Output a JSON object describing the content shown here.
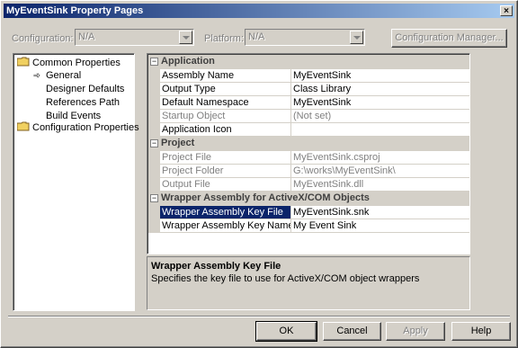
{
  "window": {
    "title": "MyEventSink Property Pages",
    "close_glyph": "×"
  },
  "toolbar": {
    "configuration_label": "Configuration:",
    "configuration_value": "N/A",
    "platform_label": "Platform:",
    "platform_value": "N/A",
    "config_manager_label": "Configuration Manager..."
  },
  "tree": {
    "items": [
      {
        "label": "Common Properties",
        "kind": "folder"
      },
      {
        "label": "General",
        "kind": "selected"
      },
      {
        "label": "Designer Defaults",
        "kind": "leaf"
      },
      {
        "label": "References Path",
        "kind": "leaf"
      },
      {
        "label": "Build Events",
        "kind": "leaf"
      },
      {
        "label": "Configuration Properties",
        "kind": "folder"
      }
    ]
  },
  "grid": {
    "categories": [
      {
        "name": "Application",
        "expander": "−",
        "rows": [
          {
            "name": "Assembly Name",
            "value": "MyEventSink"
          },
          {
            "name": "Output Type",
            "value": "Class Library"
          },
          {
            "name": "Default Namespace",
            "value": "MyEventSink"
          },
          {
            "name": "Startup Object",
            "value": "(Not set)"
          },
          {
            "name": "Application Icon",
            "value": ""
          }
        ]
      },
      {
        "name": "Project",
        "expander": "−",
        "rows": [
          {
            "name": "Project File",
            "value": "MyEventSink.csproj"
          },
          {
            "name": "Project Folder",
            "value": "G:\\works\\MyEventSink\\"
          },
          {
            "name": "Output File",
            "value": "MyEventSink.dll"
          }
        ]
      },
      {
        "name": "Wrapper Assembly for ActiveX/COM Objects",
        "expander": "−",
        "rows": [
          {
            "name": "Wrapper Assembly Key File",
            "value": "MyEventSink.snk"
          },
          {
            "name": "Wrapper Assembly Key Name",
            "value": "My Event Sink"
          }
        ]
      }
    ]
  },
  "description": {
    "title": "Wrapper Assembly Key File",
    "text": "Specifies the key file to use for ActiveX/COM object wrappers"
  },
  "buttons": {
    "ok": "OK",
    "cancel": "Cancel",
    "apply": "Apply",
    "help": "Help"
  },
  "colors": {
    "face": "#d4d0c8",
    "title_start": "#0a246a",
    "title_end": "#a6caf0",
    "selection": "#0a246a",
    "folder": "#f0d060"
  }
}
